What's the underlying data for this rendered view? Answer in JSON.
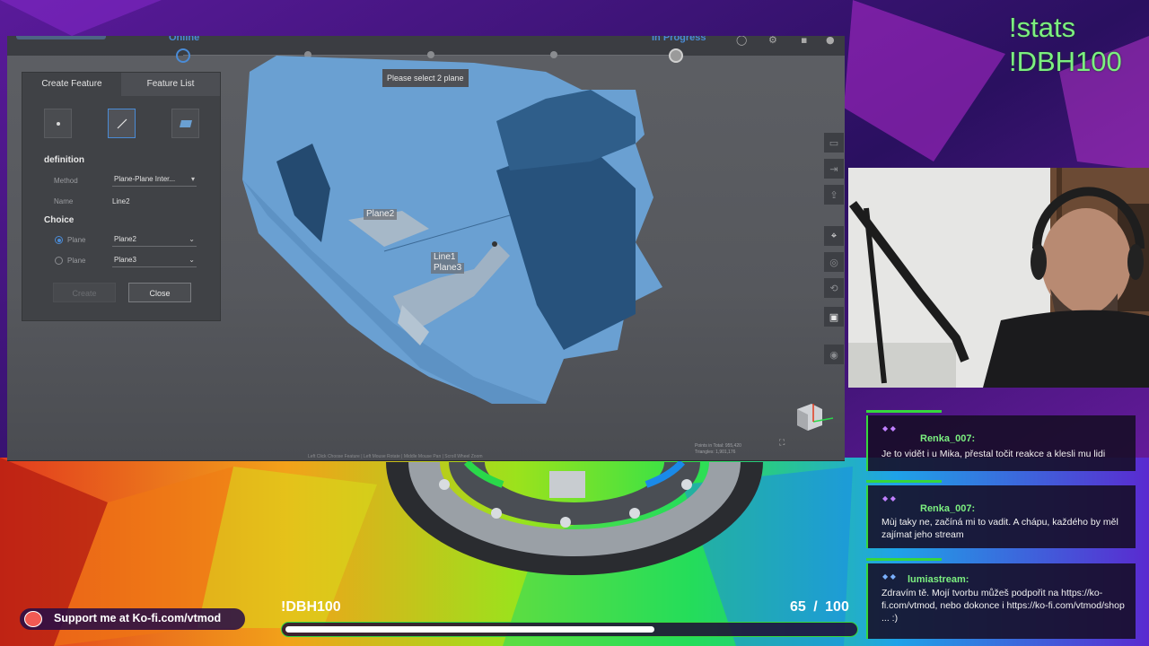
{
  "app": {
    "steps": [
      {
        "label": "Online",
        "active": true
      },
      {
        "label": "",
        "active": false
      },
      {
        "label": "",
        "active": false
      },
      {
        "label": "",
        "active": false
      },
      {
        "label": "In Progress",
        "active": true
      }
    ],
    "hint": "Please select 2 plane",
    "panel": {
      "tabs": [
        "Create Feature",
        "Feature List"
      ],
      "definition_title": "definition",
      "method_label": "Method",
      "method_value": "Plane-Plane Inter...",
      "name_label": "Name",
      "name_value": "Line2",
      "choice_title": "Choice",
      "choices": [
        {
          "label": "Plane",
          "value": "Plane2",
          "selected": true
        },
        {
          "label": "Plane",
          "value": "Plane3",
          "selected": false
        }
      ],
      "create_label": "Create",
      "close_label": "Close"
    },
    "scene_tags": {
      "plane2": "Plane2",
      "line1": "Line1",
      "plane3": "Plane3"
    },
    "points_info": [
      "Points in Total: 955,420",
      "Triangles: 1,901,176"
    ],
    "bottom_hint": "Left Click  Choose Feature  |  Left Mouse Rotate  |  Middle Mouse Pan  |  Scroll Wheel Zoom"
  },
  "overlay": {
    "commands": [
      "!stats",
      "!DBH100"
    ],
    "chat": [
      {
        "user": "Renka_007:",
        "text": "Je to vidět i u Mika, přestal točit reakce a klesli mu lidi"
      },
      {
        "user": "Renka_007:",
        "text": "Mùj taky ne, začíná mi to vadit. A chápu, každého by měl zajímat jeho stream"
      },
      {
        "user": "lumiastream:",
        "text": "Zdravím tě. Mojí tvorbu můžeš podpořit na https://ko-fi.com/vtmod, nebo dokonce i https://ko-fi.com/vtmod/shop ... :)"
      }
    ],
    "kofi_text": "Support me at Ko-fi.com/vtmod",
    "goal": {
      "label": "!DBH100",
      "current": 65,
      "separator": "/",
      "target": 100,
      "current_text": "65",
      "target_text": "100"
    }
  },
  "colors": {
    "accent_green": "#36d63d",
    "command_green": "#7cf080",
    "app_accent": "#4a8bd6",
    "scan_blue": "#6aa0d2"
  }
}
